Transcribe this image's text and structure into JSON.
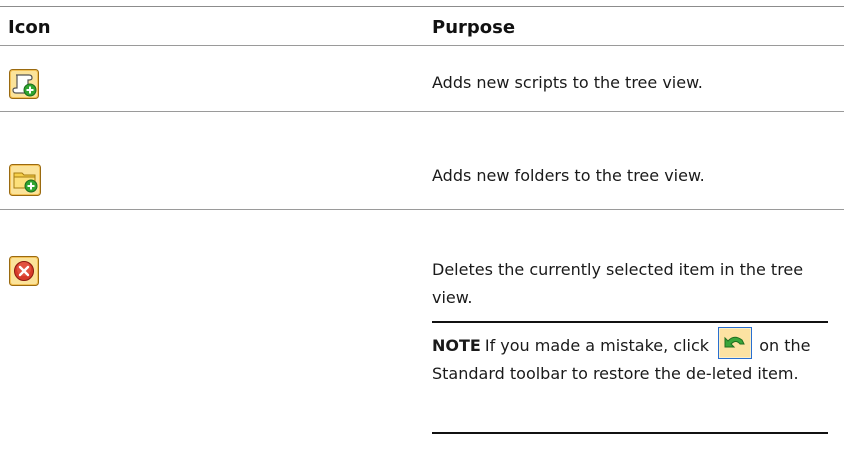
{
  "table": {
    "headers": {
      "icon": "Icon",
      "purpose": "Purpose"
    },
    "rows": [
      {
        "icon": "add-script-icon",
        "purpose": "Adds new scripts to the tree view."
      },
      {
        "icon": "add-folder-icon",
        "purpose": "Adds new folders to the tree view."
      },
      {
        "icon": "delete-icon",
        "purpose": "Deletes the currently selected item in the tree view."
      }
    ]
  },
  "note": {
    "label": "NOTE",
    "text_before": "If you made a mistake, click",
    "text_after": "on the Standard toolbar to restore the de-leted item.",
    "icon": "undo-icon"
  },
  "colors": {
    "rule": "#8c8c8c",
    "icon_gold": "#f0b840",
    "icon_green": "#2fa52f",
    "icon_red": "#d63a2a"
  }
}
